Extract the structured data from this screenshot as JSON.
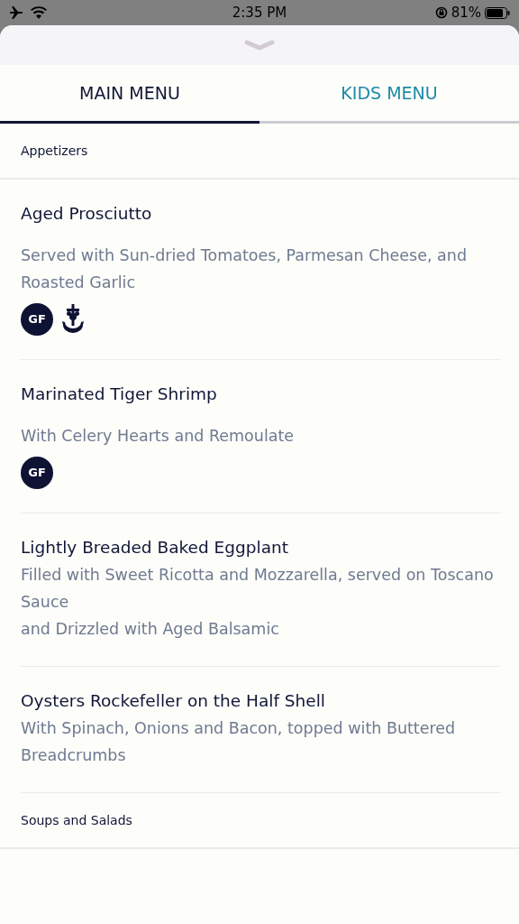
{
  "status_bar": {
    "time": "2:35 PM",
    "battery": "81%"
  },
  "tabs": [
    {
      "label": "MAIN MENU",
      "selected": true
    },
    {
      "label": "KIDS MENU",
      "selected": false
    }
  ],
  "sections": [
    {
      "title": "Appetizers",
      "items": [
        {
          "name": "Aged Prosciutto",
          "description": [
            "Served with Sun-dried Tomatoes, Parmesan Cheese, and Roasted Garlic"
          ],
          "tags": [
            {
              "kind": "gf",
              "label": "GF"
            },
            {
              "kind": "anchor"
            }
          ]
        },
        {
          "name": "Marinated Tiger Shrimp",
          "description": [
            "With Celery Hearts and Remoulate"
          ],
          "tags": [
            {
              "kind": "gf",
              "label": "GF"
            }
          ]
        },
        {
          "name": "Lightly Breaded Baked Eggplant",
          "description": [
            "Filled with Sweet Ricotta and Mozzarella, served on Toscano Sauce",
            "and Drizzled with Aged Balsamic"
          ]
        },
        {
          "name": "Oysters Rockefeller on the Half Shell",
          "description": [
            "With Spinach, Onions and Bacon, topped with Buttered Breadcrumbs"
          ]
        }
      ]
    },
    {
      "title": "Soups and Salads"
    }
  ]
}
